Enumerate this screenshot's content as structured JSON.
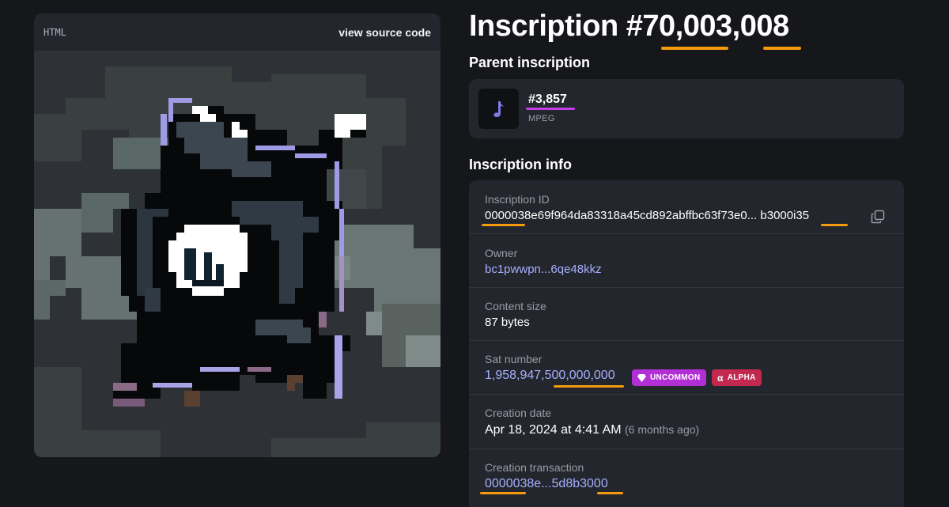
{
  "preview": {
    "content_type": "HTML",
    "view_source_label": "view source code"
  },
  "title": "Inscription #70,003,008",
  "parent": {
    "heading": "Parent inscription",
    "number": "#3,857",
    "mime": "MPEG",
    "icon": "music-note-icon"
  },
  "info": {
    "heading": "Inscription info",
    "inscription_id_label": "Inscription ID",
    "inscription_id": "0000038e69f964da83318a45cd892abffbc63f73e0... b3000i35",
    "owner_label": "Owner",
    "owner": "bc1pwwpn...6qe48kkz",
    "content_size_label": "Content size",
    "content_size": "87 bytes",
    "sat_number_label": "Sat number",
    "sat_number": "1,958,947,500,000,000",
    "badge_uncommon": "UNCOMMON",
    "badge_alpha": "ALPHA",
    "creation_date_label": "Creation date",
    "creation_date": "Apr 18, 2024 at 4:41 AM",
    "creation_date_relative": "(6 months ago)",
    "creation_tx_label": "Creation transaction",
    "creation_tx": "0000038e...5d8b3000"
  },
  "colors": {
    "highlight_orange": "#f59a0c",
    "highlight_purple": "#c13ee6",
    "link": "#a5b0ff",
    "badge_uncommon": "#b22fd6",
    "badge_alpha": "#c3284f"
  }
}
